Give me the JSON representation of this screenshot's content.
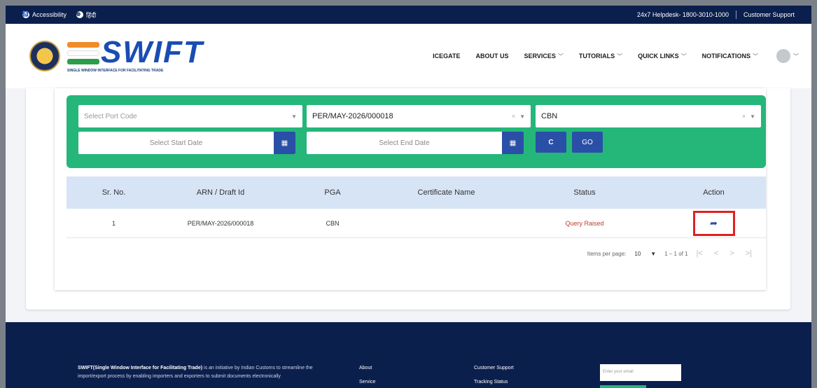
{
  "topbar": {
    "accessibility": "Accessibility",
    "language": "हिंदी",
    "helpdesk": "24x7 Helpdesk- 1800-3010-1000",
    "support": "Customer Support"
  },
  "header": {
    "logo_text": "SWIFT",
    "logo_sub": "SINGLE WINDOW INTERFACE FOR FACILITATING TRADE",
    "nav": [
      {
        "label": "ICEGATE",
        "dropdown": false
      },
      {
        "label": "ABOUT US",
        "dropdown": false
      },
      {
        "label": "SERVICES",
        "dropdown": true
      },
      {
        "label": "TUTORIALS",
        "dropdown": true
      },
      {
        "label": "QUICK LINKS",
        "dropdown": true
      },
      {
        "label": "NOTIFICATIONS",
        "dropdown": true
      }
    ]
  },
  "filters": {
    "port_code_placeholder": "Select Port Code",
    "arn_value": "PER/MAY-2026/000018",
    "pga_value": "CBN",
    "start_date_placeholder": "Select Start Date",
    "end_date_placeholder": "Select End Date",
    "refresh_label": "C",
    "go_label": "GO"
  },
  "table": {
    "headers": [
      "Sr. No.",
      "ARN / Draft Id",
      "PGA",
      "Certificate Name",
      "Status",
      "Action"
    ],
    "rows": [
      {
        "sr": "1",
        "arn": "PER/MAY-2026/000018",
        "pga": "CBN",
        "certificate": "",
        "status": "Query Raised"
      }
    ]
  },
  "pagination": {
    "items_label": "Items per page:",
    "items_value": "10",
    "range": "1 – 1 of 1"
  },
  "footer": {
    "desc_bold": "SWIFT(Single Window Interface for Facilitating Trade)",
    "desc_rest": " is an initiative by Indian Customs to streamline the import/export process by enabling importers and exporters to submit documents electronically",
    "col1": [
      "About",
      "Service"
    ],
    "col2": [
      "Customer Support",
      "Tracking Status"
    ],
    "email_placeholder": "Enter your email"
  },
  "colors": {
    "navy": "#0b1f4d",
    "green": "#25b67a",
    "blue": "#2a4fa6",
    "header_row": "#d6e4f5",
    "status_red": "#c0392b",
    "highlight": "#e02020"
  }
}
